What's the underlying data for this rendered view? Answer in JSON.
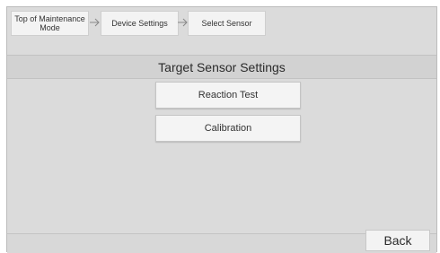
{
  "breadcrumb": {
    "items": [
      {
        "label": "Top of Maintenance\nMode"
      },
      {
        "label": "Device Settings"
      },
      {
        "label": "Select Sensor"
      }
    ],
    "separator_icon": "arrow-right-icon"
  },
  "title": "Target Sensor Settings",
  "menu": {
    "buttons": [
      {
        "label": "Reaction Test"
      },
      {
        "label": "Calibration"
      }
    ]
  },
  "footer": {
    "back_label": "Back"
  }
}
